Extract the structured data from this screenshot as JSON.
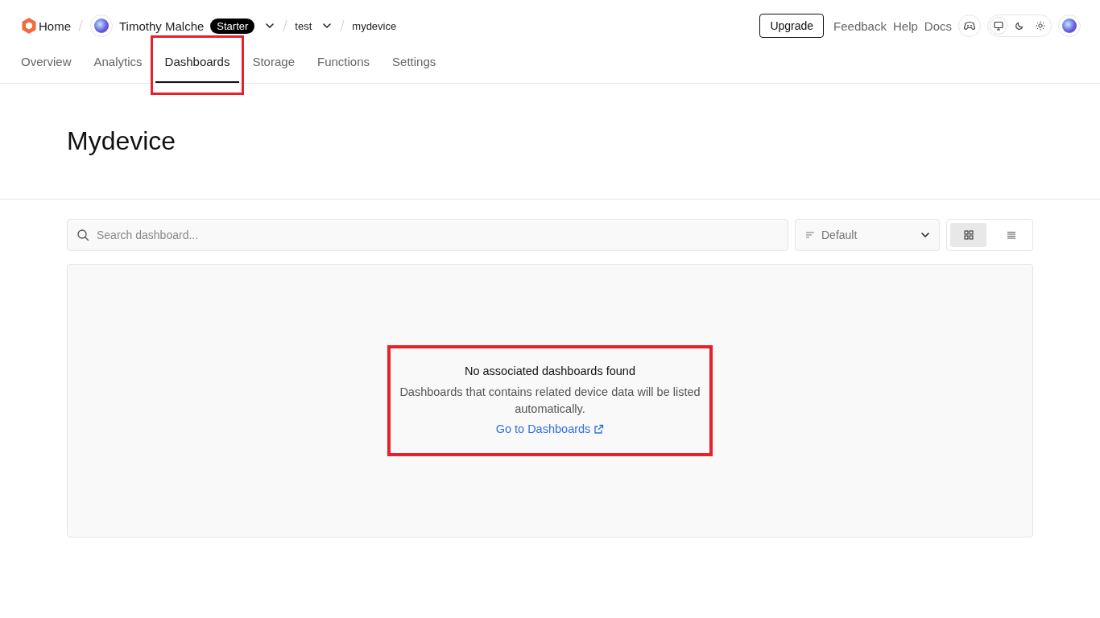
{
  "breadcrumb": {
    "home": "Home",
    "user": "Timothy Malche",
    "plan_badge": "Starter",
    "project": "test",
    "device": "mydevice"
  },
  "header_actions": {
    "upgrade": "Upgrade",
    "links": [
      "Feedback",
      "Help",
      "Docs"
    ]
  },
  "theme_modes": [
    {
      "kind": "system",
      "selected": true
    },
    {
      "kind": "dark",
      "selected": false
    },
    {
      "kind": "light",
      "selected": false
    }
  ],
  "tabs": [
    {
      "label": "Overview",
      "selected": false,
      "highlighted": false
    },
    {
      "label": "Analytics",
      "selected": false,
      "highlighted": false
    },
    {
      "label": "Dashboards",
      "selected": true,
      "highlighted": true
    },
    {
      "label": "Storage",
      "selected": false,
      "highlighted": false
    },
    {
      "label": "Functions",
      "selected": false,
      "highlighted": false
    },
    {
      "label": "Settings",
      "selected": false,
      "highlighted": false
    }
  ],
  "page_title": "Mydevice",
  "search": {
    "placeholder": "Search dashboard..."
  },
  "sort": {
    "value": "Default"
  },
  "view_modes": [
    {
      "kind": "grid",
      "selected": true
    },
    {
      "kind": "list",
      "selected": false
    }
  ],
  "empty_state": {
    "title": "No associated dashboards found",
    "message": "Dashboards that contains related device data will be listed automatically.",
    "link": "Go to Dashboards",
    "highlighted": true
  }
}
